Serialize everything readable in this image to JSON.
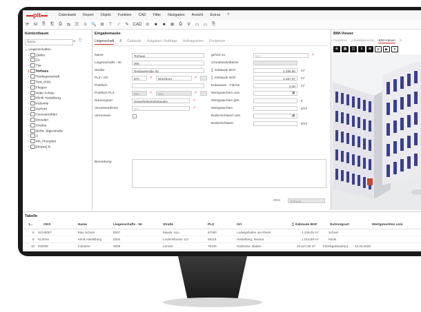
{
  "app": {
    "logo": "pit",
    "menu": [
      "Datenbank",
      "Report",
      "Objekt",
      "Funktion",
      "CAD",
      "Filter",
      "Navigation",
      "Ansicht",
      "Extras",
      "?"
    ],
    "toolbar": [
      "⟳",
      "⛁",
      "⎘",
      "⎗",
      "⎙",
      "⇆",
      "☷",
      "≡",
      "🔍",
      "⊟",
      "⊤",
      "∕",
      "✎",
      "CAD",
      "⊙",
      "■",
      "■",
      "⊠",
      "⎙",
      "⚲",
      "▭",
      "▭",
      "⎘"
    ]
  },
  "left_panel": {
    "title": "Kontextbaum",
    "search_placeholder": "Name",
    "clear": "×",
    "tree": [
      "Liegenschaften",
      "Zähler",
      "Zo",
      "Tier",
      "Torhaus",
      "Testliegenschaft",
      "Test_0001",
      "Fliegen",
      "Wäle Schule",
      "Klinik Heidelberg",
      "Industrie",
      "Herford",
      "Grevesmühlen",
      "Dresden",
      "Charite",
      "Berlin Jägerstraße",
      "A",
      "4th_Floorplan",
      "[dropre] B"
    ]
  },
  "entry_panel": {
    "title": "Eingabemaske",
    "tabs": [
      "Liegenschaft",
      "8",
      "Gebäude",
      "Aufgaben / Aufträge",
      "Auftragsarten",
      "Ereignisse"
    ],
    "left_fields": [
      {
        "label": "Name",
        "value": "Torhaus"
      },
      {
        "label": "Liegenschafts - Nr.",
        "value": "005"
      },
      {
        "label": "Straße",
        "value": "Neubaustraße 30"
      },
      {
        "label": "PLZ / Ort",
        "value": "970",
        "value2": "Würzburg"
      },
      {
        "label": "Postfach",
        "value": ""
      },
      {
        "label": "Postfach PLZ",
        "value": "904",
        "value2": "904"
      },
      {
        "label": "Nutzungsart",
        "value": "Gewerbebetriebsbauten"
      },
      {
        "label": "Verantwortlicher",
        "value": "N/A"
      },
      {
        "label": "Vermessen",
        "value": ""
      }
    ],
    "right_fields": [
      {
        "label": "gehört zu",
        "value": "N/A"
      },
      {
        "label": "Grundstücksfläche",
        "value": ""
      },
      {
        "label": "∑ Gebäude BGF",
        "value": "4.295,90",
        "unit": "m²"
      },
      {
        "label": "∑ Gebäude NGF",
        "value": "4.167,07",
        "unit": "m²"
      },
      {
        "label": "Erdwasser - Fläche",
        "value": "0,00",
        "unit": "m²"
      },
      {
        "label": "Wertgutachten vom",
        "value": ""
      },
      {
        "label": "Wertgutachten ges.",
        "value": "",
        "unit": "€"
      },
      {
        "label": "Wertgutachten",
        "value": "",
        "unit": "€/m²"
      },
      {
        "label": "Bodenrichtwert vom",
        "value": ""
      },
      {
        "label": "Bodenrichtwert",
        "value": "",
        "unit": "€/m²"
      }
    ],
    "remarks_label": "Bemerkung",
    "oks_label": "OKS",
    "oks_value": "Torhaus"
  },
  "bim_panel": {
    "title": "BIM-Viewer",
    "tabs": [
      "Favoriten",
      "Arbeitsbereiche",
      "BIM-Viewer",
      "D"
    ],
    "tools": [
      "⊛",
      "▦",
      "◫",
      "ℹ",
      "⊕",
      "⊘",
      "▶",
      "✕"
    ]
  },
  "table": {
    "title": "Tabelle",
    "headers": [
      "1...",
      "OKS",
      "Name",
      "Liegenschafts - Nr.",
      "Straße",
      "PLZ",
      "Ort",
      "∑ Gebäude BGF",
      "Nutzungsart",
      "Wertgutachten vom"
    ],
    "rows": [
      [
        "6",
        "SCH0007",
        "Max Schule",
        "0007",
        "Maxstr. 61a",
        "67080",
        "Ludwigshafen am Rhein",
        "4.248,05 m²",
        "Schule",
        ""
      ],
      [
        "9",
        "KL0004",
        "Klinik Heidelberg",
        "0004",
        "Lindenstrasse 112",
        "69115",
        "Heidelberg, Neckar",
        "1.016,69 m²",
        "Klinik",
        ""
      ],
      [
        "10",
        "IN0008",
        "Industrie",
        "0008",
        "Lornstr.",
        "76135",
        "Karlsruhe, Baden",
        "10.527,08 m²",
        "Fabrikgebäude(n)",
        "12.02.2020"
      ]
    ]
  }
}
